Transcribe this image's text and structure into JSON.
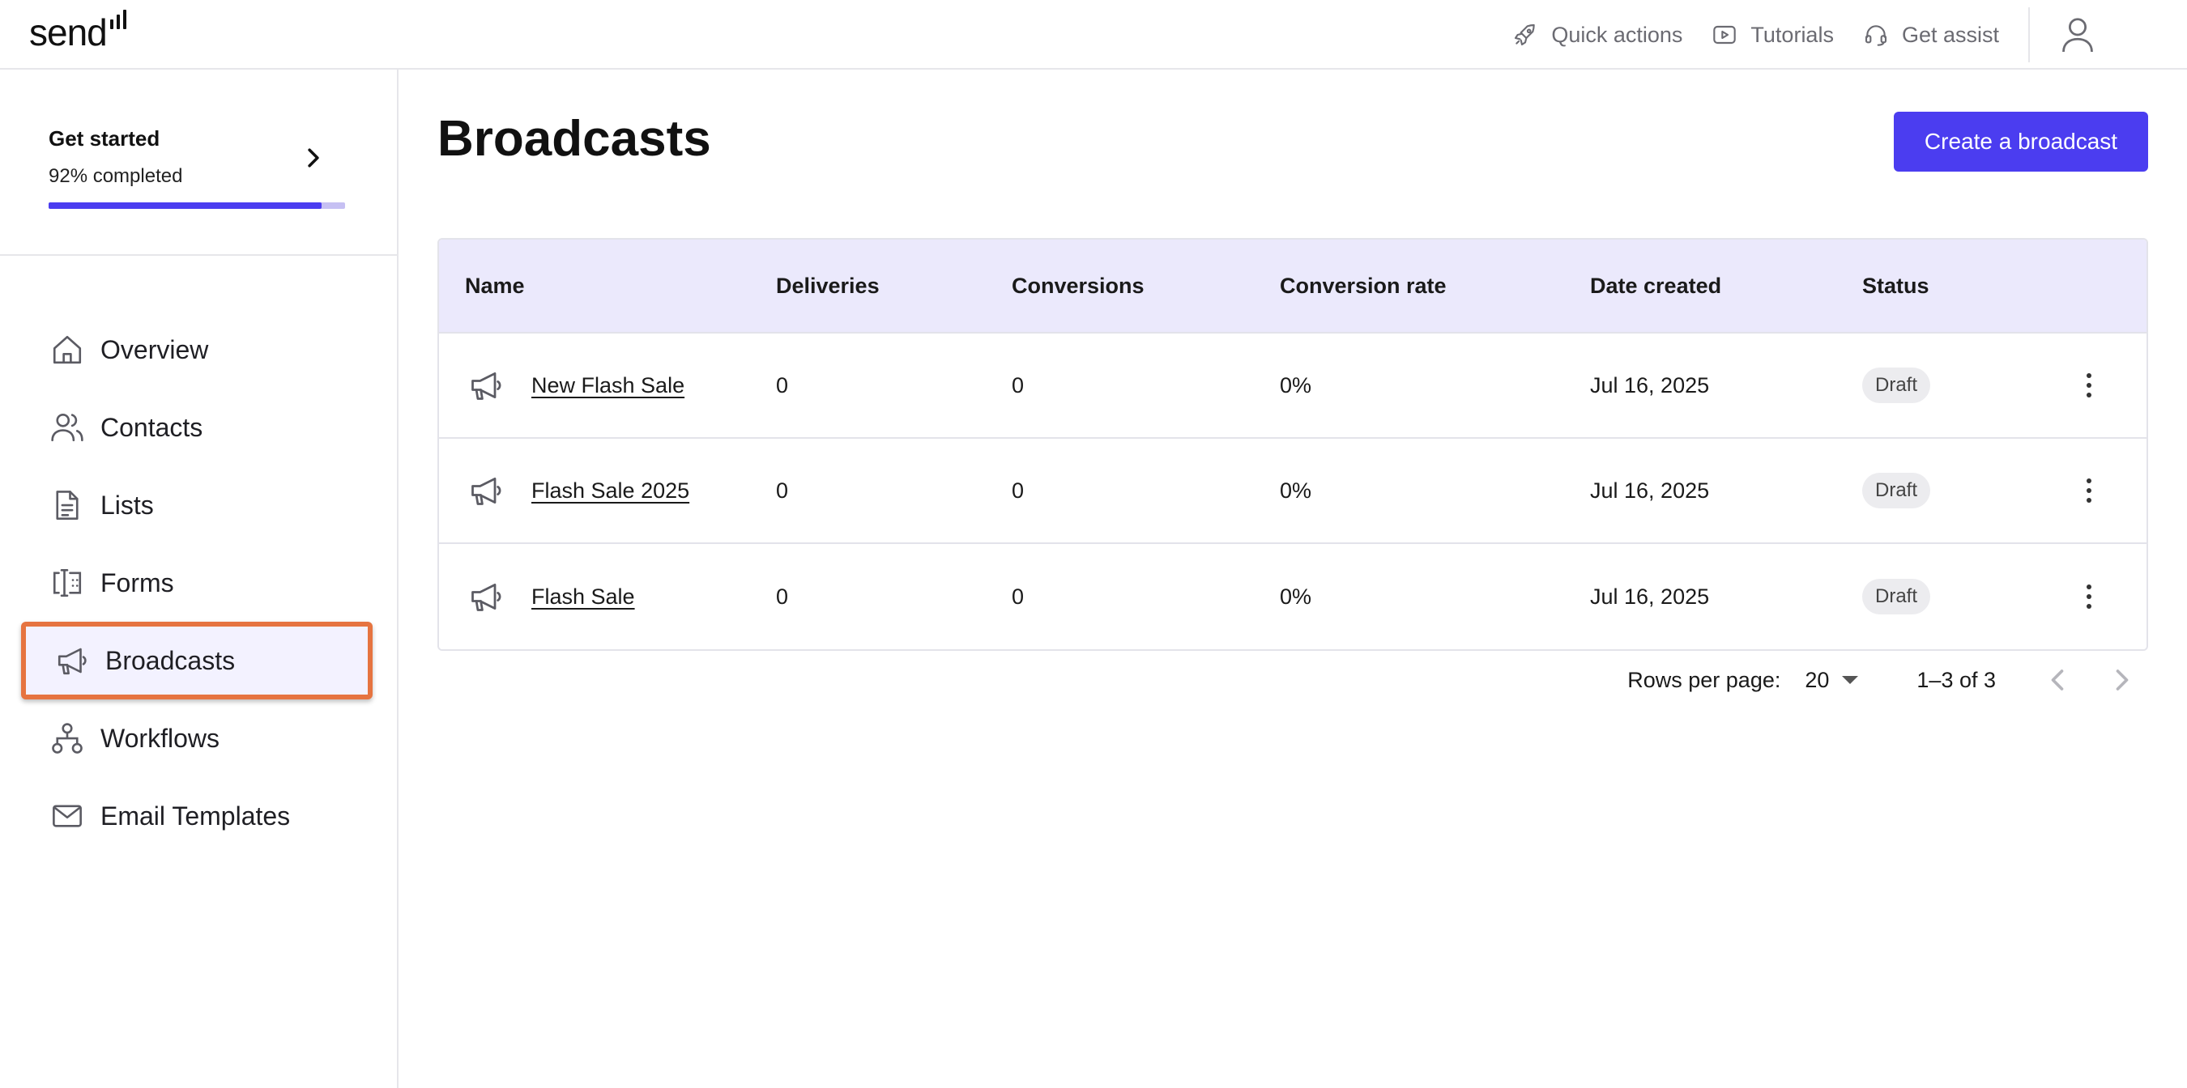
{
  "app": {
    "logo_text": "send"
  },
  "topbar": {
    "quick_actions": "Quick actions",
    "tutorials": "Tutorials",
    "get_assist": "Get assist"
  },
  "sidebar": {
    "get_started": {
      "title": "Get started",
      "subtitle": "92% completed",
      "progress_percent": 92
    },
    "items": [
      {
        "label": "Overview",
        "icon": "home-icon",
        "active": false
      },
      {
        "label": "Contacts",
        "icon": "users-icon",
        "active": false
      },
      {
        "label": "Lists",
        "icon": "document-icon",
        "active": false
      },
      {
        "label": "Forms",
        "icon": "form-icon",
        "active": false
      },
      {
        "label": "Broadcasts",
        "icon": "megaphone-icon",
        "active": true
      },
      {
        "label": "Workflows",
        "icon": "workflow-icon",
        "active": false
      },
      {
        "label": "Email Templates",
        "icon": "mail-icon",
        "active": false
      }
    ]
  },
  "main": {
    "title": "Broadcasts",
    "create_button": "Create a broadcast",
    "table": {
      "columns": [
        "Name",
        "Deliveries",
        "Conversions",
        "Conversion rate",
        "Date created",
        "Status"
      ],
      "rows": [
        {
          "name": "New Flash Sale",
          "deliveries": "0",
          "conversions": "0",
          "rate": "0%",
          "date": "Jul 16, 2025",
          "status": "Draft"
        },
        {
          "name": "Flash Sale 2025",
          "deliveries": "0",
          "conversions": "0",
          "rate": "0%",
          "date": "Jul 16, 2025",
          "status": "Draft"
        },
        {
          "name": "Flash Sale",
          "deliveries": "0",
          "conversions": "0",
          "rate": "0%",
          "date": "Jul 16, 2025",
          "status": "Draft"
        }
      ]
    },
    "pagination": {
      "rows_per_page_label": "Rows per page:",
      "rows_per_page_value": "20",
      "range": "1–3 of 3"
    }
  },
  "colors": {
    "accent": "#4b3df0",
    "highlight": "#e67440",
    "header_bg": "#ebe9fc"
  }
}
